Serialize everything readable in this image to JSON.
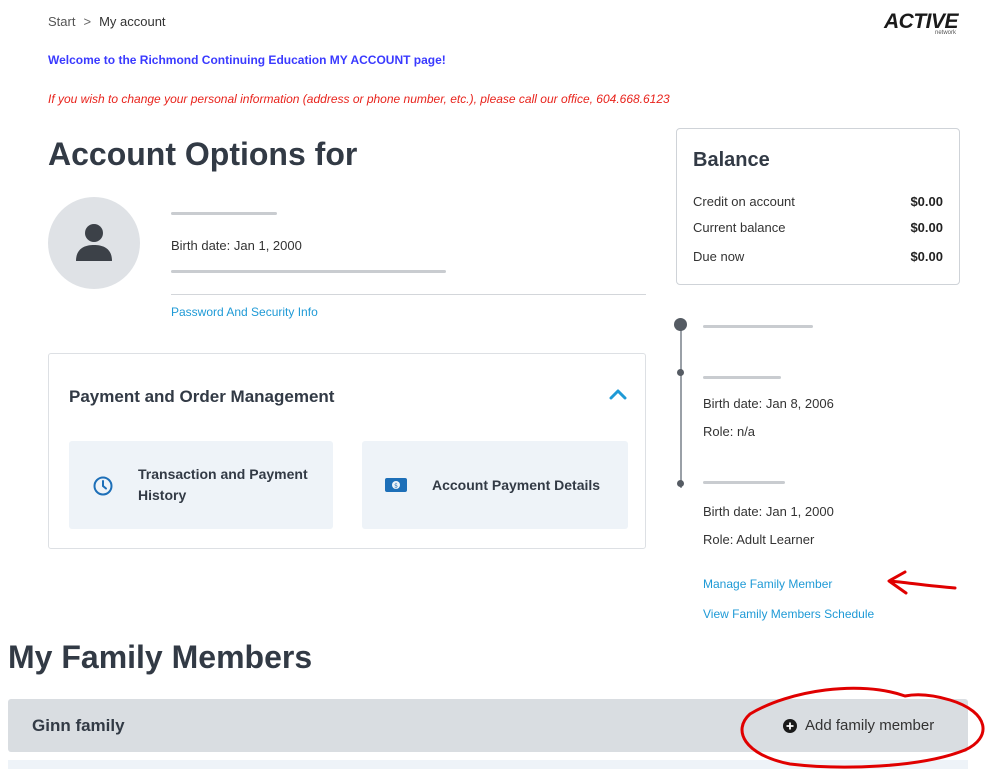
{
  "breadcrumb": {
    "start": "Start",
    "separator": ">",
    "current": "My account"
  },
  "brand": {
    "name": "ACTIVE",
    "sub": "network"
  },
  "messages": {
    "welcome": "Welcome to the Richmond Continuing Education MY ACCOUNT page!",
    "notice": "If you wish to change your personal information (address or phone number, etc.), please call our office, 604.668.6123"
  },
  "account": {
    "title": "Account Options for",
    "birth_label": "Birth date:",
    "birth_value": "Jan 1, 2000",
    "password_link": "Password And Security Info"
  },
  "payment": {
    "title": "Payment and Order Management",
    "tiles": [
      {
        "label_line1": "Transaction and Payment",
        "label_line2": "History",
        "icon": "clock-icon"
      },
      {
        "label": "Account Payment Details",
        "icon": "money-icon"
      }
    ]
  },
  "balance": {
    "title": "Balance",
    "rows": [
      {
        "label": "Credit on account",
        "value": "$0.00"
      },
      {
        "label": "Current balance",
        "value": "$0.00"
      },
      {
        "label": "Due now",
        "value": "$0.00"
      }
    ]
  },
  "family_sidebar": {
    "members": [
      {
        "birth": "Birth date: Jan 8, 2006",
        "role": "Role: n/a"
      },
      {
        "birth": "Birth date: Jan 1, 2000",
        "role": "Role: Adult Learner"
      }
    ],
    "manage_link": "Manage Family Member",
    "schedule_link": "View Family Members Schedule"
  },
  "family": {
    "title": "My Family Members",
    "family_name": "Ginn family",
    "add_button": "Add family member"
  },
  "colors": {
    "link": "#1f9ad6",
    "welcome": "#3a3aff",
    "notice": "#e8231c",
    "annotation": "#e00000"
  }
}
